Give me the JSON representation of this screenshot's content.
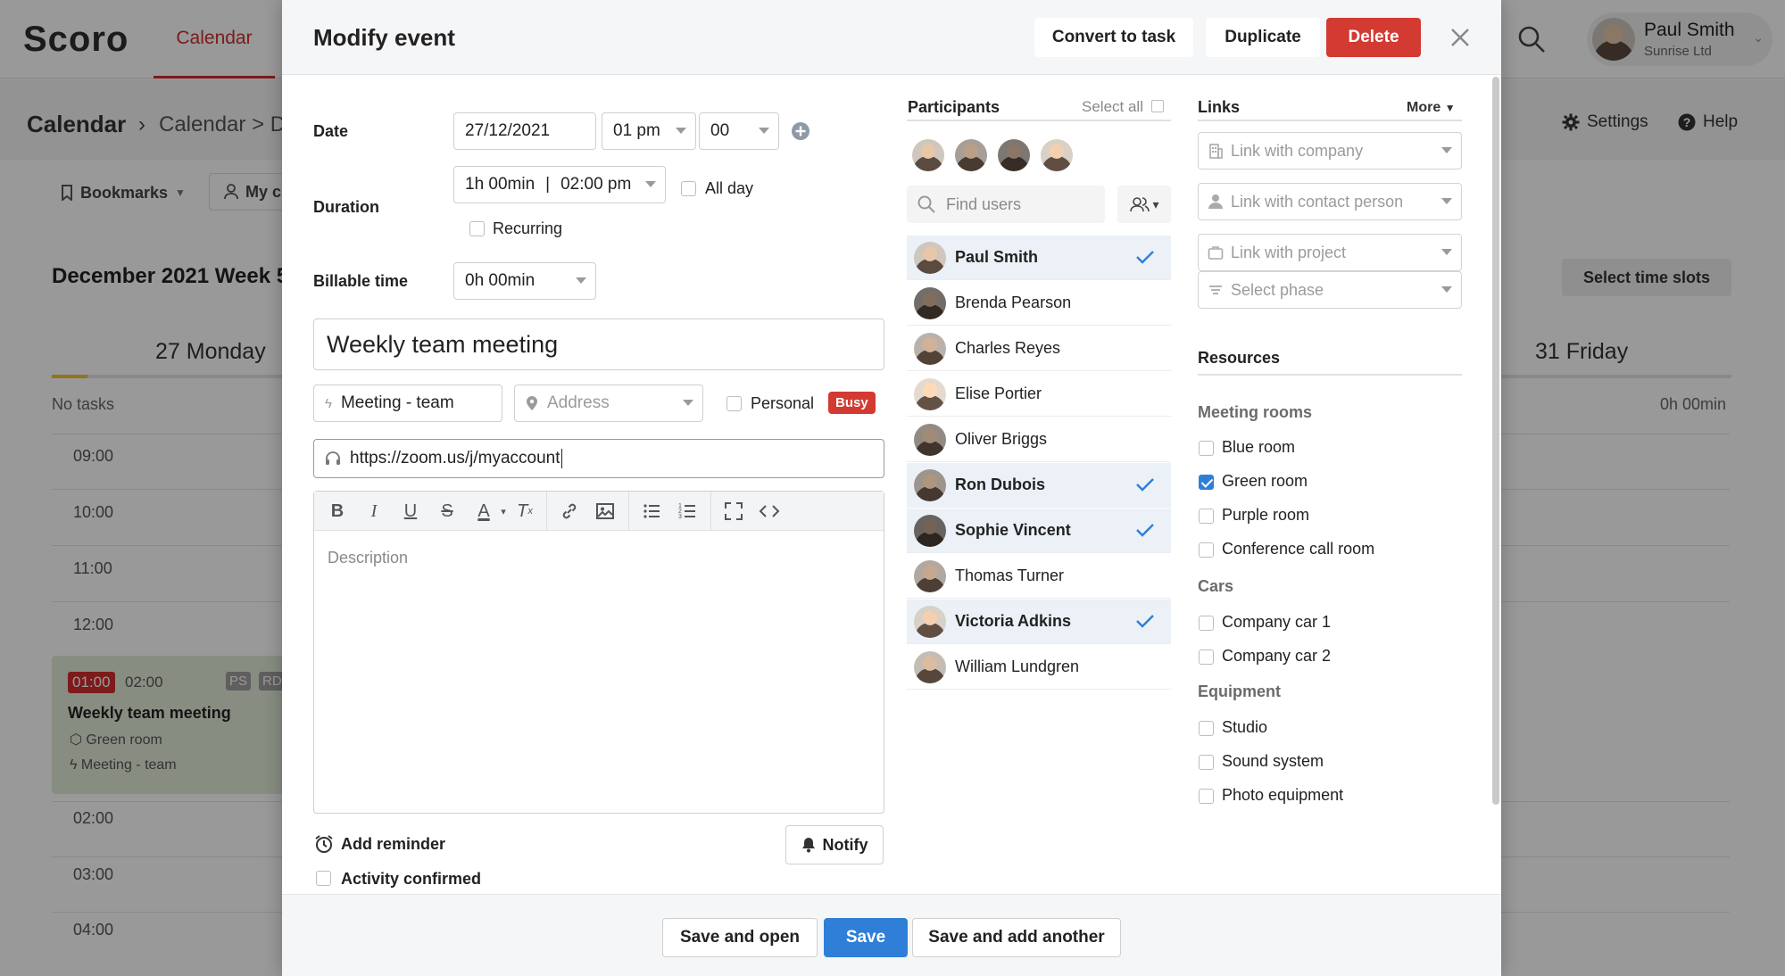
{
  "app": {
    "logo": "Scoro",
    "top_tab": "Calendar",
    "user": {
      "name": "Paul Smith",
      "company": "Sunrise Ltd"
    }
  },
  "background": {
    "breadcrumb": {
      "title": "Calendar",
      "sep": "›",
      "sub": "Calendar > D"
    },
    "settings": "Settings",
    "help": "Help",
    "bookmarks": "Bookmarks",
    "my_filter": "My c",
    "week_title": "December 2021 Week 5",
    "select_time_slots": "Select time slots",
    "days": [
      {
        "label": "27  Monday"
      },
      {
        "label": "31  Friday"
      }
    ],
    "no_tasks": "No tasks",
    "day_total": "0h 00min",
    "hours": [
      "09:00",
      "10:00",
      "11:00",
      "12:00",
      "02:00",
      "03:00",
      "04:00"
    ],
    "event": {
      "start": "01:00",
      "end": "02:00",
      "tags": [
        "PS",
        "RD"
      ],
      "title": "Weekly team meeting",
      "room": "Green room",
      "type": "Meeting - team"
    }
  },
  "modal": {
    "title": "Modify event",
    "buttons": {
      "convert": "Convert to task",
      "duplicate": "Duplicate",
      "delete": "Delete"
    },
    "date": {
      "label": "Date",
      "value": "27/12/2021",
      "hour": "01 pm",
      "minute": "00"
    },
    "duration": {
      "label": "Duration",
      "value": "1h 00min",
      "end": "02:00 pm",
      "all_day": "All day",
      "recurring": "Recurring"
    },
    "billable": {
      "label": "Billable time",
      "value": "0h 00min"
    },
    "event_title": "Weekly team meeting",
    "activity_type": "Meeting - team",
    "address_placeholder": "Address",
    "personal": "Personal",
    "busy": "Busy",
    "meeting_link": "https://zoom.us/j/myaccount",
    "description_placeholder": "Description",
    "add_reminder": "Add reminder",
    "notify": "Notify",
    "activity_confirmed": "Activity confirmed",
    "footer": {
      "save_open": "Save and open",
      "save": "Save",
      "save_add": "Save and add another"
    }
  },
  "participants": {
    "title": "Participants",
    "select_all": "Select all",
    "find_placeholder": "Find users",
    "list": [
      {
        "name": "Paul Smith",
        "selected": true
      },
      {
        "name": "Brenda Pearson",
        "selected": false
      },
      {
        "name": "Charles Reyes",
        "selected": false
      },
      {
        "name": "Elise Portier",
        "selected": false
      },
      {
        "name": "Oliver Briggs",
        "selected": false
      },
      {
        "name": "Ron Dubois",
        "selected": true
      },
      {
        "name": "Sophie Vincent",
        "selected": true
      },
      {
        "name": "Thomas Turner",
        "selected": false
      },
      {
        "name": "Victoria Adkins",
        "selected": true
      },
      {
        "name": "William Lundgren",
        "selected": false
      }
    ]
  },
  "links": {
    "title": "Links",
    "more": "More",
    "company": "Link with company",
    "contact": "Link with contact person",
    "project": "Link with project",
    "phase": "Select phase"
  },
  "resources": {
    "title": "Resources",
    "groups": [
      {
        "name": "Meeting rooms",
        "items": [
          {
            "label": "Blue room",
            "checked": false
          },
          {
            "label": "Green room",
            "checked": true
          },
          {
            "label": "Purple room",
            "checked": false
          },
          {
            "label": "Conference call room",
            "checked": false
          }
        ]
      },
      {
        "name": "Cars",
        "items": [
          {
            "label": "Company car 1",
            "checked": false
          },
          {
            "label": "Company car 2",
            "checked": false
          }
        ]
      },
      {
        "name": "Equipment",
        "items": [
          {
            "label": "Studio",
            "checked": false
          },
          {
            "label": "Sound system",
            "checked": false
          },
          {
            "label": "Photo equipment",
            "checked": false
          }
        ]
      }
    ]
  },
  "colors": {
    "accent_red": "#d23a32",
    "primary_blue": "#2f7fd8",
    "selected_row": "#ebf1f7"
  }
}
